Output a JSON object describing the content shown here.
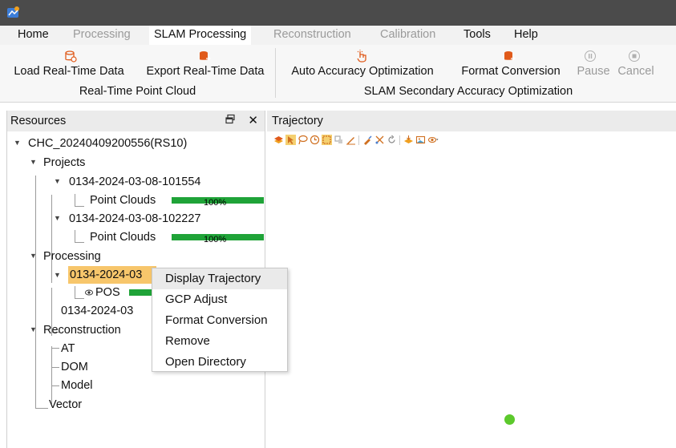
{
  "menu": {
    "home": "Home",
    "processing": "Processing",
    "slam_processing": "SLAM Processing",
    "reconstruction": "Reconstruction",
    "calibration": "Calibration",
    "tools": "Tools",
    "help": "Help"
  },
  "ribbon": {
    "load_realtime": "Load Real-Time Data",
    "export_realtime": "Export Real-Time Data",
    "auto_accuracy": "Auto Accuracy Optimization",
    "format_conversion": "Format Conversion",
    "pause": "Pause",
    "cancel": "Cancel",
    "group_realtime": "Real-Time Point Cloud",
    "group_slam": "SLAM Secondary Accuracy Optimization"
  },
  "resources": {
    "title": "Resources",
    "close_glyph": "✕",
    "root": "CHC_20240409200556(RS10)",
    "projects": "Projects",
    "project1": "0134-2024-03-08-101554",
    "project1_child": "Point Clouds",
    "project1_progress": "100%",
    "project2": "0134-2024-03-08-102227",
    "project2_child": "Point Clouds",
    "project2_progress": "100%",
    "processing": "Processing",
    "proc1": "0134-2024-03",
    "proc1_child": "POS",
    "proc2": "0134-2024-03",
    "reconstruction": "Reconstruction",
    "at": "AT",
    "dom": "DOM",
    "model": "Model",
    "vector": "Vector"
  },
  "trajectory": {
    "title": "Trajectory"
  },
  "context_menu": {
    "items": [
      "Display Trajectory",
      "GCP Adjust",
      "Format Conversion",
      "Remove",
      "Open Directory"
    ]
  },
  "colors": {
    "progress": "#1fa338",
    "selection": "#f7c66b",
    "point": "#5cc92c",
    "titlebar": "#4b4b4b"
  }
}
